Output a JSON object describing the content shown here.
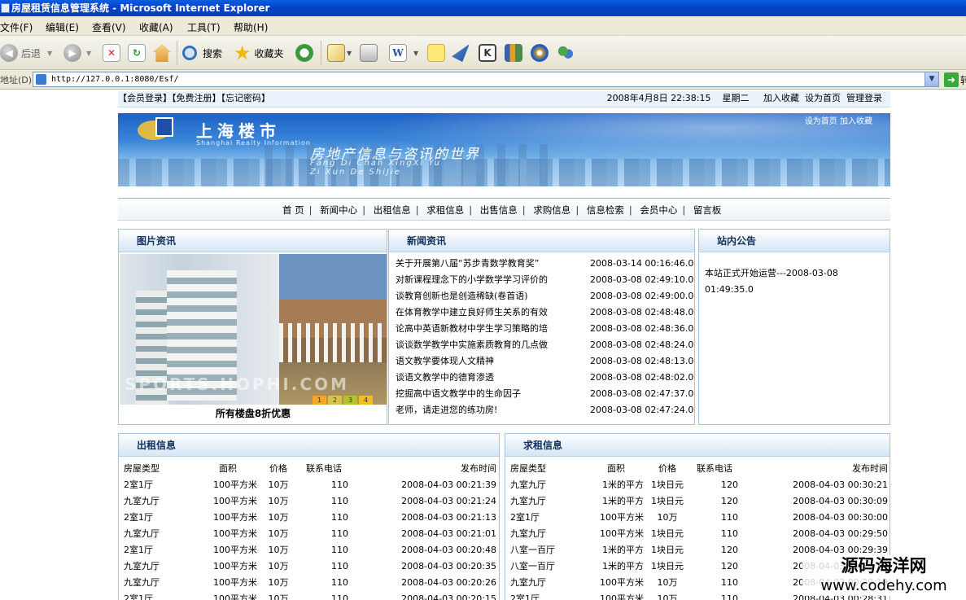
{
  "window": {
    "title": "房屋租赁信息管理系统 - Microsoft Internet Explorer"
  },
  "menu": [
    "文件(F)",
    "编辑(E)",
    "查看(V)",
    "收藏(A)",
    "工具(T)",
    "帮助(H)"
  ],
  "toolbar": {
    "back": "后退",
    "search": "搜索",
    "favorites": "收藏夹"
  },
  "address": {
    "label": "地址(D)",
    "url": "http://127.0.0.1:8080/Esf/",
    "go_partial": "转"
  },
  "topstrip": {
    "left": "【会员登录】【免费注册】【忘记密码】",
    "datetime": "2008年4月8日 22:38:15",
    "weekday": "星期二",
    "links": [
      "加入收藏",
      "设为首页",
      "管理登录"
    ]
  },
  "banner": {
    "logo_text": "上海楼市",
    "logo_sub": "Shanghai Realty Information",
    "slogan": "房地产信息与咨讯的世界",
    "pinyin1": "Fang Di Chan XingXi Yu",
    "pinyin2": "Zi Xun De ShiJie",
    "toplinks": "设为首页    加入收藏"
  },
  "nav": [
    "首 页",
    "新闻中心",
    "出租信息",
    "求租信息",
    "出售信息",
    "求购信息",
    "信息检索",
    "会员中心",
    "留言板"
  ],
  "photo_panel": {
    "title": "图片资讯",
    "caption": "所有楼盘8折优惠",
    "watermark": "SPORTS.HOPHI.COM",
    "pager": [
      "1",
      "2",
      "3",
      "4"
    ]
  },
  "news_panel": {
    "title": "新闻资讯",
    "items": [
      {
        "title": "关于开展第八届“苏步青数学教育奖”",
        "date": "2008-03-14 00:16:46.0"
      },
      {
        "title": "对新课程理念下的小学数学学习评价的",
        "date": "2008-03-08 02:49:10.0"
      },
      {
        "title": "谈教育创新也是创造稀缺(卷首语)",
        "date": "2008-03-08 02:49:00.0"
      },
      {
        "title": "在体育教学中建立良好师生关系的有效",
        "date": "2008-03-08 02:48:48.0"
      },
      {
        "title": "论高中英语新教材中学生学习策略的培",
        "date": "2008-03-08 02:48:36.0"
      },
      {
        "title": "谈谈数学教学中实施素质教育的几点做",
        "date": "2008-03-08 02:48:24.0"
      },
      {
        "title": "语文教学要体现人文精神",
        "date": "2008-03-08 02:48:13.0"
      },
      {
        "title": "谈语文教学中的德育渗透",
        "date": "2008-03-08 02:48:02.0"
      },
      {
        "title": "挖掘高中语文教学中的生命因子",
        "date": "2008-03-08 02:47:37.0"
      },
      {
        "title": "老师，请走进您的练功房!",
        "date": "2008-03-08 02:47:24.0"
      }
    ]
  },
  "notice_panel": {
    "title": "站内公告",
    "text": "本站正式开始运营---2008-03-08 01:49:35.0"
  },
  "rent_panel": {
    "title": "出租信息",
    "headers": [
      "房屋类型",
      "面积",
      "价格",
      "联系电话",
      "发布时间"
    ],
    "rows": [
      [
        "2室1厅",
        "100平方米",
        "10万",
        "110",
        "2008-04-03 00:21:39"
      ],
      [
        "九室九厅",
        "100平方米",
        "10万",
        "110",
        "2008-04-03 00:21:24"
      ],
      [
        "2室1厅",
        "100平方米",
        "10万",
        "110",
        "2008-04-03 00:21:13"
      ],
      [
        "九室九厅",
        "100平方米",
        "10万",
        "110",
        "2008-04-03 00:21:01"
      ],
      [
        "2室1厅",
        "100平方米",
        "10万",
        "110",
        "2008-04-03 00:20:48"
      ],
      [
        "九室九厅",
        "100平方米",
        "10万",
        "110",
        "2008-04-03 00:20:35"
      ],
      [
        "九室九厅",
        "100平方米",
        "10万",
        "110",
        "2008-04-03 00:20:26"
      ],
      [
        "2室1厅",
        "100平方米",
        "10万",
        "110",
        "2008-04-03 00:20:15"
      ]
    ]
  },
  "seek_panel": {
    "title": "求租信息",
    "headers": [
      "房屋类型",
      "面积",
      "价格",
      "联系电话",
      "发布时间"
    ],
    "rows": [
      [
        "九室九厅",
        "1米的平方",
        "1块日元",
        "120",
        "2008-04-03 00:30:21"
      ],
      [
        "九室九厅",
        "1米的平方",
        "1块日元",
        "120",
        "2008-04-03 00:30:09"
      ],
      [
        "2室1厅",
        "100平方米",
        "10万",
        "110",
        "2008-04-03 00:30:00"
      ],
      [
        "九室九厅",
        "100平方米",
        "1块日元",
        "110",
        "2008-04-03 00:29:50"
      ],
      [
        "八室一百厅",
        "1米的平方",
        "1块日元",
        "120",
        "2008-04-03 00:29:39"
      ],
      [
        "八室一百厅",
        "1米的平方",
        "1块日元",
        "120",
        "2008-04-03 00:29:30"
      ],
      [
        "九室九厅",
        "100平方米",
        "10万",
        "110",
        "2008-04-03 00:29:19"
      ],
      [
        "2室1厅",
        "100平方米",
        "10万",
        "110",
        "2008-04-03 00:28:31"
      ]
    ]
  },
  "watermark": {
    "line1": "源码海洋网",
    "line2": "www.codehy.com"
  }
}
